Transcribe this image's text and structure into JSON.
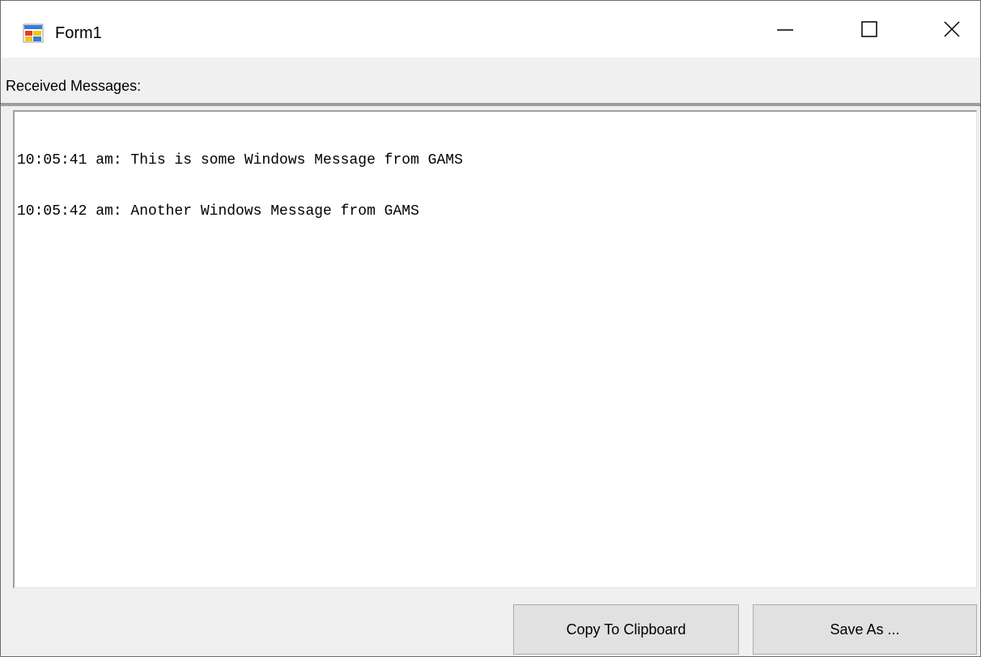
{
  "window": {
    "title": "Form1",
    "icon": "winforms-app-icon"
  },
  "caption_buttons": {
    "minimize_icon": "minimize-icon",
    "maximize_icon": "maximize-icon",
    "close_icon": "close-icon"
  },
  "main": {
    "label": "Received Messages:",
    "messages": [
      "10:05:41 am: This is some Windows Message from GAMS",
      "10:05:42 am: Another Windows Message from GAMS"
    ]
  },
  "buttons": {
    "copy_label": "Copy To Clipboard",
    "save_label": "Save As ..."
  }
}
